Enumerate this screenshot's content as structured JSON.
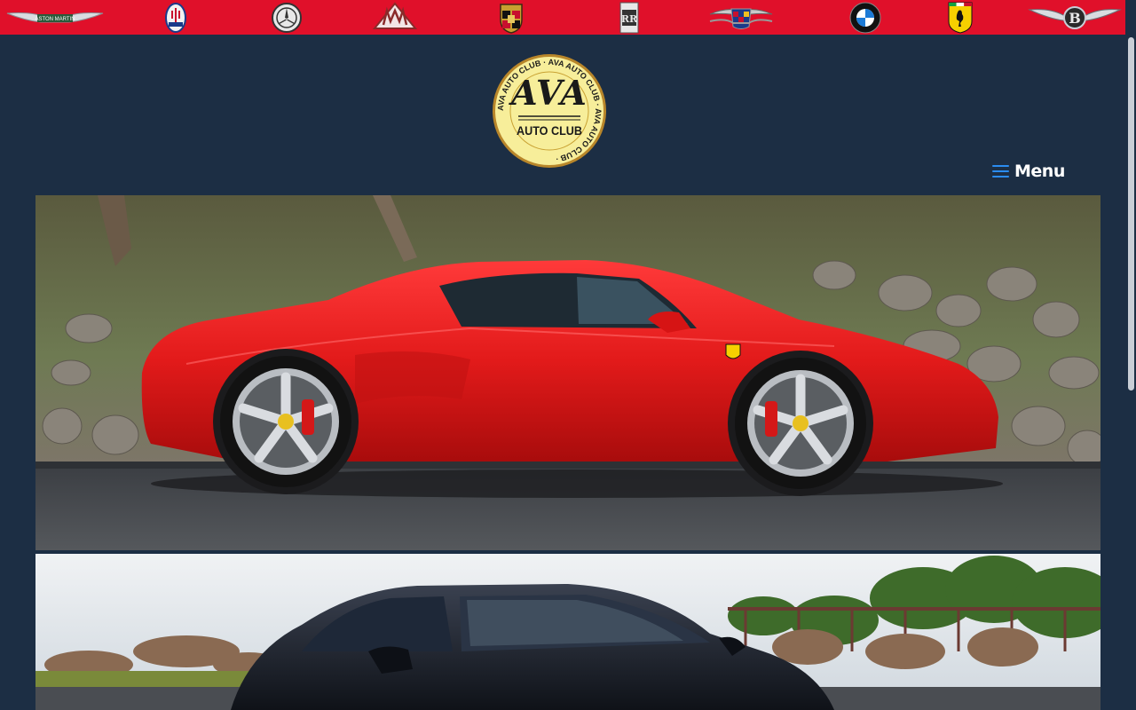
{
  "brands": [
    {
      "name": "Aston Martin",
      "icon": "aston-martin-logo-icon",
      "text": "ASTON MARTIN"
    },
    {
      "name": "Maserati",
      "icon": "maserati-logo-icon"
    },
    {
      "name": "Mercedes-Benz",
      "icon": "mercedes-benz-logo-icon"
    },
    {
      "name": "Maybach",
      "icon": "maybach-logo-icon"
    },
    {
      "name": "Porsche",
      "icon": "porsche-logo-icon"
    },
    {
      "name": "Rolls-Royce",
      "icon": "rolls-royce-logo-icon"
    },
    {
      "name": "Cadillac",
      "icon": "cadillac-logo-icon"
    },
    {
      "name": "BMW",
      "icon": "bmw-logo-icon"
    },
    {
      "name": "Ferrari",
      "icon": "ferrari-logo-icon"
    },
    {
      "name": "Bentley",
      "icon": "bentley-logo-icon"
    }
  ],
  "header": {
    "logo": {
      "main": "AVA",
      "sub": "AUTO CLUB",
      "ring_text": "AVA AUTO CLUB"
    },
    "menu_label": "Menu"
  },
  "heroes": [
    {
      "subject": "red-ferrari-458",
      "icon": "red-sports-car-photo"
    },
    {
      "subject": "black-sedan",
      "icon": "black-sedan-photo"
    }
  ],
  "colors": {
    "brand_bar": "#e0102a",
    "background": "#1c2e44",
    "menu_icon": "#2b8cf0",
    "logo_fill": "#f7ee9a",
    "logo_border": "#c9a233"
  }
}
